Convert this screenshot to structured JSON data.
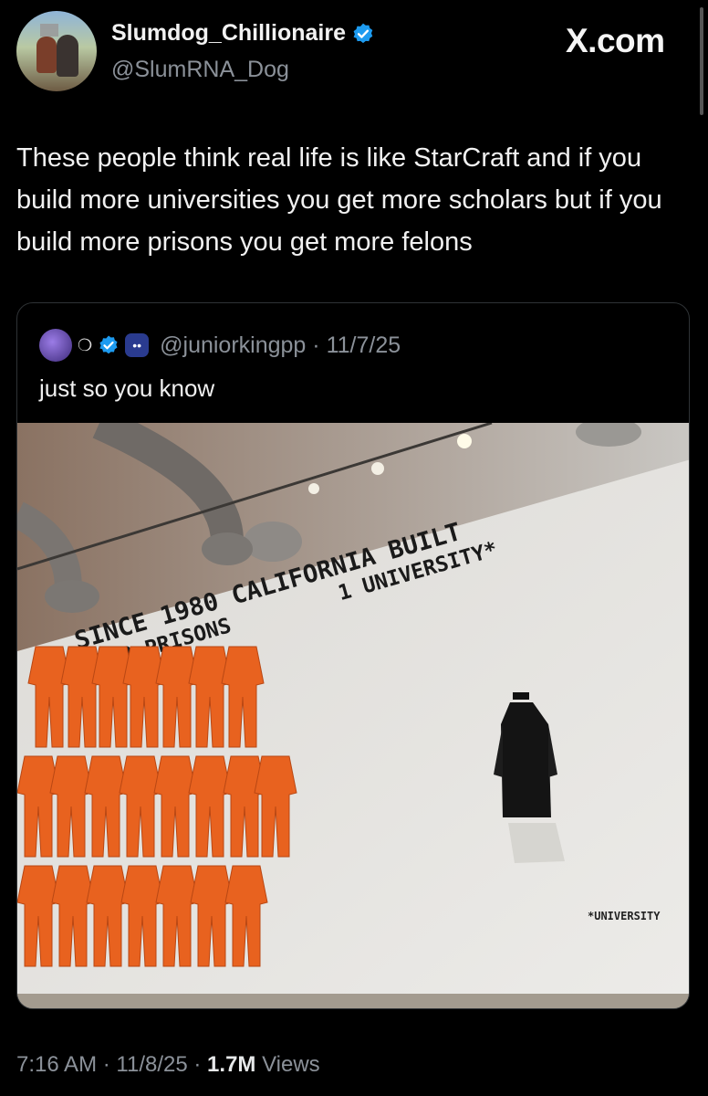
{
  "tweet": {
    "display_name": "Slumdog_Chillionaire",
    "handle": "@SlumRNA_Dog",
    "source_label": "X.com",
    "text": "These people think real life is like StarCraft and if you build more universities you get more scholars but if you build more prisons you get more felons",
    "time": "7:16 AM",
    "date": "11/8/25",
    "views": "1.7M",
    "views_label": "Views",
    "separator": "·"
  },
  "quoted": {
    "handle": "@juniorkingpp",
    "date": "11/7/25",
    "text": "just so you know",
    "image": {
      "wall_line1_left": "SINCE 1980 CALIFORNIA BUILT",
      "wall_line2_left": "22 PRISONS",
      "wall_line2_right": "1 UNIVERSITY*",
      "footnote": "*UNIVERSITY"
    }
  },
  "colors": {
    "verified": "#1d9bf0",
    "jumpsuit": "#e8621f",
    "muted_text": "#8b9199"
  },
  "icons": [
    "verified-badge-icon",
    "x-logo-icon",
    "eye-badge-icon"
  ]
}
